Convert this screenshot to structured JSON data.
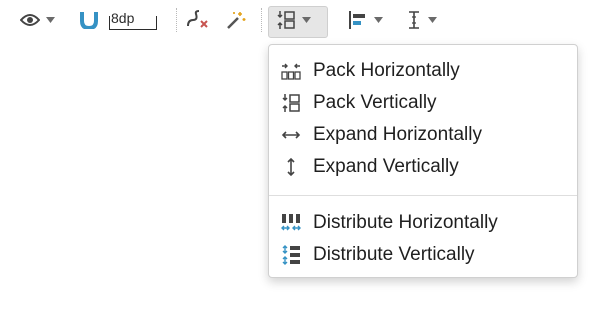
{
  "toolbar": {
    "margin_value": "8dp",
    "buttons": [
      {
        "name": "eye-icon",
        "has_menu": true
      },
      {
        "name": "magnet-icon",
        "has_menu": false
      },
      {
        "name": "clear-constraints-icon",
        "has_menu": false
      },
      {
        "name": "magic-wand-icon",
        "has_menu": false
      },
      {
        "name": "pack-icon",
        "has_menu": true
      },
      {
        "name": "align-icon",
        "has_menu": true
      },
      {
        "name": "guidelines-icon",
        "has_menu": true
      }
    ],
    "accent_color": "#3592c4",
    "warning_color": "#c75450"
  },
  "menu": {
    "group1": [
      {
        "label": "Pack Horizontally",
        "icon": "pack-horizontally-icon"
      },
      {
        "label": "Pack Vertically",
        "icon": "pack-vertically-icon"
      },
      {
        "label": "Expand Horizontally",
        "icon": "expand-horizontally-icon"
      },
      {
        "label": "Expand Vertically",
        "icon": "expand-vertically-icon"
      }
    ],
    "group2": [
      {
        "label": "Distribute Horizontally",
        "icon": "distribute-horizontally-icon"
      },
      {
        "label": "Distribute Vertically",
        "icon": "distribute-vertically-icon"
      }
    ]
  }
}
